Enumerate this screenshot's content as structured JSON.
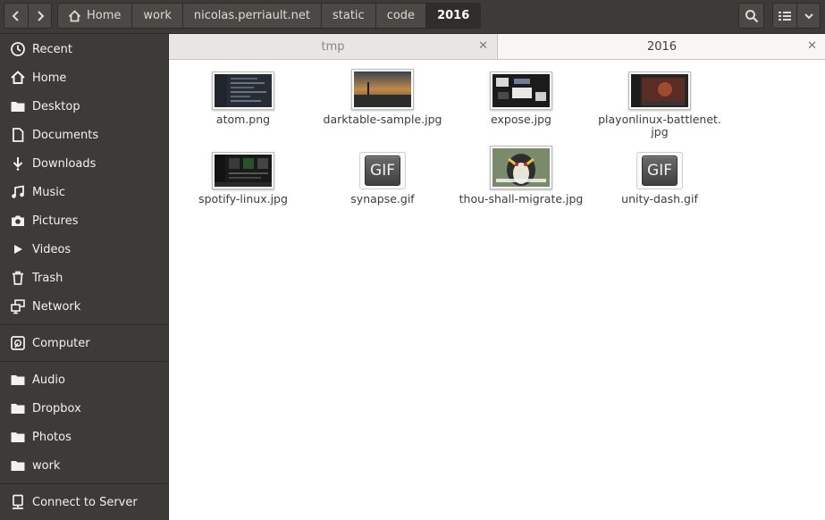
{
  "breadcrumbs": [
    {
      "label": "Home",
      "icon": "home-icon"
    },
    {
      "label": "work"
    },
    {
      "label": "nicolas.perriault.net"
    },
    {
      "label": "static"
    },
    {
      "label": "code"
    },
    {
      "label": "2016",
      "active": true
    }
  ],
  "sidebar": {
    "places": [
      {
        "label": "Recent",
        "icon": "recent-icon"
      },
      {
        "label": "Home",
        "icon": "home-icon"
      },
      {
        "label": "Desktop",
        "icon": "folder-icon"
      },
      {
        "label": "Documents",
        "icon": "document-icon"
      },
      {
        "label": "Downloads",
        "icon": "download-icon"
      },
      {
        "label": "Music",
        "icon": "music-icon"
      },
      {
        "label": "Pictures",
        "icon": "camera-icon"
      },
      {
        "label": "Videos",
        "icon": "video-icon"
      },
      {
        "label": "Trash",
        "icon": "trash-icon"
      },
      {
        "label": "Network",
        "icon": "network-icon"
      }
    ],
    "devices": [
      {
        "label": "Computer",
        "icon": "computer-icon"
      }
    ],
    "bookmarks": [
      {
        "label": "Audio",
        "icon": "folder-icon"
      },
      {
        "label": "Dropbox",
        "icon": "folder-icon"
      },
      {
        "label": "Photos",
        "icon": "folder-icon"
      },
      {
        "label": "work",
        "icon": "folder-icon"
      }
    ],
    "other": [
      {
        "label": "Connect to Server",
        "icon": "server-icon"
      }
    ]
  },
  "tabs": [
    {
      "label": "tmp",
      "active": false
    },
    {
      "label": "2016",
      "active": true
    }
  ],
  "files": [
    {
      "name": "atom.png",
      "kind": "thumb-dark"
    },
    {
      "name": "darktable-sample.jpg",
      "kind": "thumb-sunset"
    },
    {
      "name": "expose.jpg",
      "kind": "thumb-expose"
    },
    {
      "name": "playonlinux-battlenet.\njpg",
      "kind": "thumb-battlenet"
    },
    {
      "name": "spotify-linux.jpg",
      "kind": "thumb-spotify"
    },
    {
      "name": "synapse.gif",
      "kind": "gif",
      "badge": "GIF"
    },
    {
      "name": "thou-shall-migrate.jpg",
      "kind": "thumb-penguin"
    },
    {
      "name": "unity-dash.gif",
      "kind": "gif",
      "badge": "GIF"
    }
  ],
  "colors": {
    "chrome": "#3c3b37",
    "content_bg": "#ffffff",
    "text_light": "#f2f1f0"
  }
}
